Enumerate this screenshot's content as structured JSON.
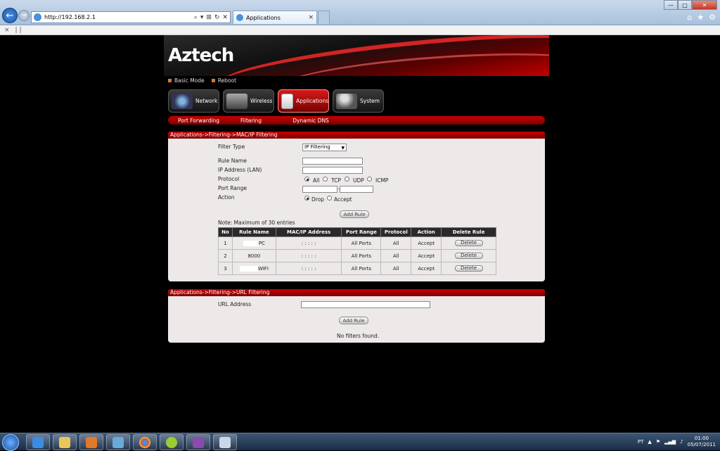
{
  "browser": {
    "url": "http://192.168.2.1",
    "tab_title": "Applications",
    "tab_close": "×",
    "cmd_close": "×",
    "cmd_sep": "| |",
    "back_glyph": "←",
    "fwd_glyph": "→",
    "addr_controls": [
      "⌕",
      "▾",
      "⊞",
      "↻",
      "✕"
    ],
    "right_icons": [
      "⌂",
      "★",
      "⚙"
    ],
    "window_controls": [
      "—",
      "□",
      "✕"
    ]
  },
  "header": {
    "logo": "Aztech"
  },
  "quick_links": [
    "Basic Mode",
    "Reboot"
  ],
  "main_tabs": [
    {
      "label": "Network",
      "icon": "network-icon"
    },
    {
      "label": "Wireless",
      "icon": "router-icon"
    },
    {
      "label": "Applications",
      "icon": "applications-icon",
      "active": true
    },
    {
      "label": "System",
      "icon": "system-icon"
    }
  ],
  "sub_tabs": [
    "Port Forwarding",
    "Filtering",
    "Dynamic DNS"
  ],
  "mac_filter": {
    "title": "Applications->Filtering->MAC/IP Filtering",
    "filter_type_label": "Filter Type",
    "filter_type_value": "IP Filtering",
    "rule_name_label": "Rule Name",
    "rule_name_value": "",
    "ip_label": "IP Address (LAN)",
    "ip_value": "",
    "protocol_label": "Protocol",
    "protocol_options": [
      "All",
      "TCP",
      "UDP",
      "ICMP"
    ],
    "protocol_selected": "All",
    "port_range_label": "Port Range",
    "port_range_sep": "-",
    "port_from": "",
    "port_to": "",
    "action_label": "Action",
    "action_options": [
      "Drop",
      "Accept"
    ],
    "action_selected": "Drop",
    "add_rule": "Add Rule",
    "note": "Note: Maximum of 30 entries",
    "table": {
      "headers": [
        "No",
        "Rule Name",
        "MAC/IP Address",
        "Port Range",
        "Protocol",
        "Action",
        "Delete Rule"
      ],
      "rows": [
        {
          "no": "1",
          "rule_name": "PC",
          "mac_ip": ": : : : :",
          "port_range": "All Ports",
          "protocol": "All",
          "action": "Accept",
          "delete": "Delete"
        },
        {
          "no": "2",
          "rule_name": "8000",
          "mac_ip": ": : : : :",
          "port_range": "All Ports",
          "protocol": "All",
          "action": "Accept",
          "delete": "Delete"
        },
        {
          "no": "3",
          "rule_name": "WIFI",
          "mac_ip": ": : : : :",
          "port_range": "All Ports",
          "protocol": "All",
          "action": "Accept",
          "delete": "Delete"
        }
      ]
    }
  },
  "url_filter": {
    "title": "Applications->Filtering->URL Filtering",
    "url_label": "URL Address",
    "url_value": "",
    "add_rule": "Add Rule",
    "empty_message": "No filters found."
  },
  "taskbar": {
    "language": "PT",
    "time": "01:00",
    "date": "05/07/2011",
    "apps": [
      "ie-icon",
      "explorer-icon",
      "media-player-icon",
      "network-app-icon",
      "chrome-icon",
      "app-icon",
      "winrar-icon",
      "notepad-icon"
    ]
  },
  "colors": {
    "accent_red": "#c80000",
    "panel_bg": "#ece9e8",
    "page_bg": "#000000"
  }
}
